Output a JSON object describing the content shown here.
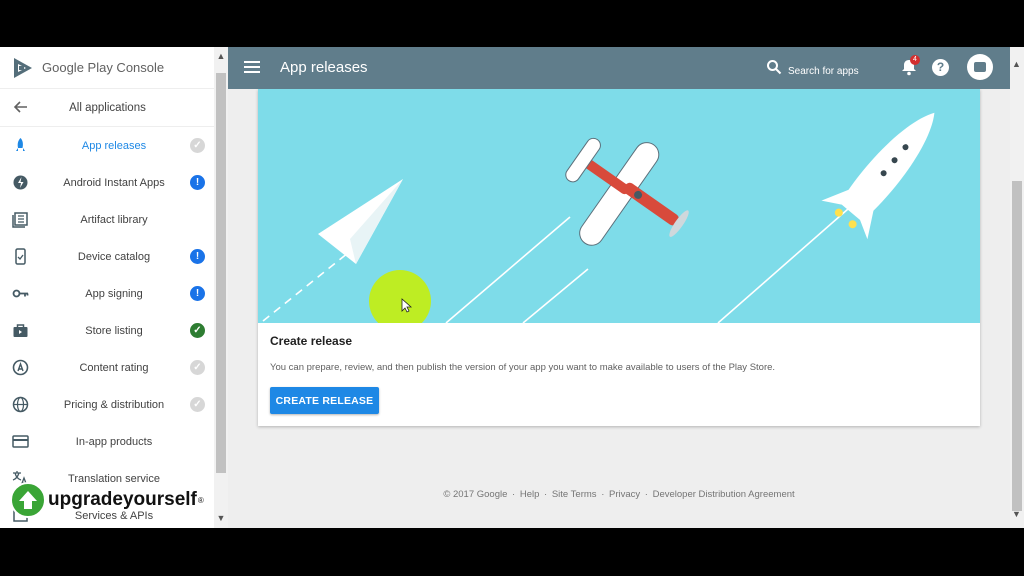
{
  "app": {
    "logo_text": "Google Play Console"
  },
  "sidebar": {
    "back_label": "All applications",
    "items": [
      {
        "label": "App releases",
        "icon": "rocket-icon",
        "status": "done",
        "active": true
      },
      {
        "label": "Android Instant Apps",
        "icon": "bolt-icon",
        "status": "attention"
      },
      {
        "label": "Artifact library",
        "icon": "library-icon",
        "status": "none"
      },
      {
        "label": "Device catalog",
        "icon": "device-icon",
        "status": "attention"
      },
      {
        "label": "App signing",
        "icon": "key-icon",
        "status": "attention"
      },
      {
        "label": "Store listing",
        "icon": "bag-icon",
        "status": "complete"
      },
      {
        "label": "Content rating",
        "icon": "rating-icon",
        "status": "done"
      },
      {
        "label": "Pricing & distribution",
        "icon": "globe-icon",
        "status": "done"
      },
      {
        "label": "In-app products",
        "icon": "card-icon",
        "status": "none"
      },
      {
        "label": "Translation service",
        "icon": "translate-icon",
        "status": "none"
      },
      {
        "label": "Services & APIs",
        "icon": "api-icon",
        "status": "none"
      }
    ]
  },
  "header": {
    "title": "App releases",
    "search_placeholder": "Search for apps",
    "notification_count": "4",
    "help_label": "?"
  },
  "card": {
    "title": "Create release",
    "description": "You can prepare, review, and then publish the version of your app you want to make available to users of the Play Store.",
    "button_label": "CREATE RELEASE"
  },
  "footer": {
    "links": [
      "© 2017 Google",
      "Help",
      "Site Terms",
      "Privacy",
      "Developer Distribution Agreement"
    ]
  },
  "watermark": {
    "text": "upgradeyourself",
    "reg": "®"
  },
  "colors": {
    "topbar": "#607d8b",
    "accent": "#1e88e5",
    "hero": "#7edce9",
    "status_blue": "#1a73e8",
    "status_green": "#2e7d32"
  }
}
